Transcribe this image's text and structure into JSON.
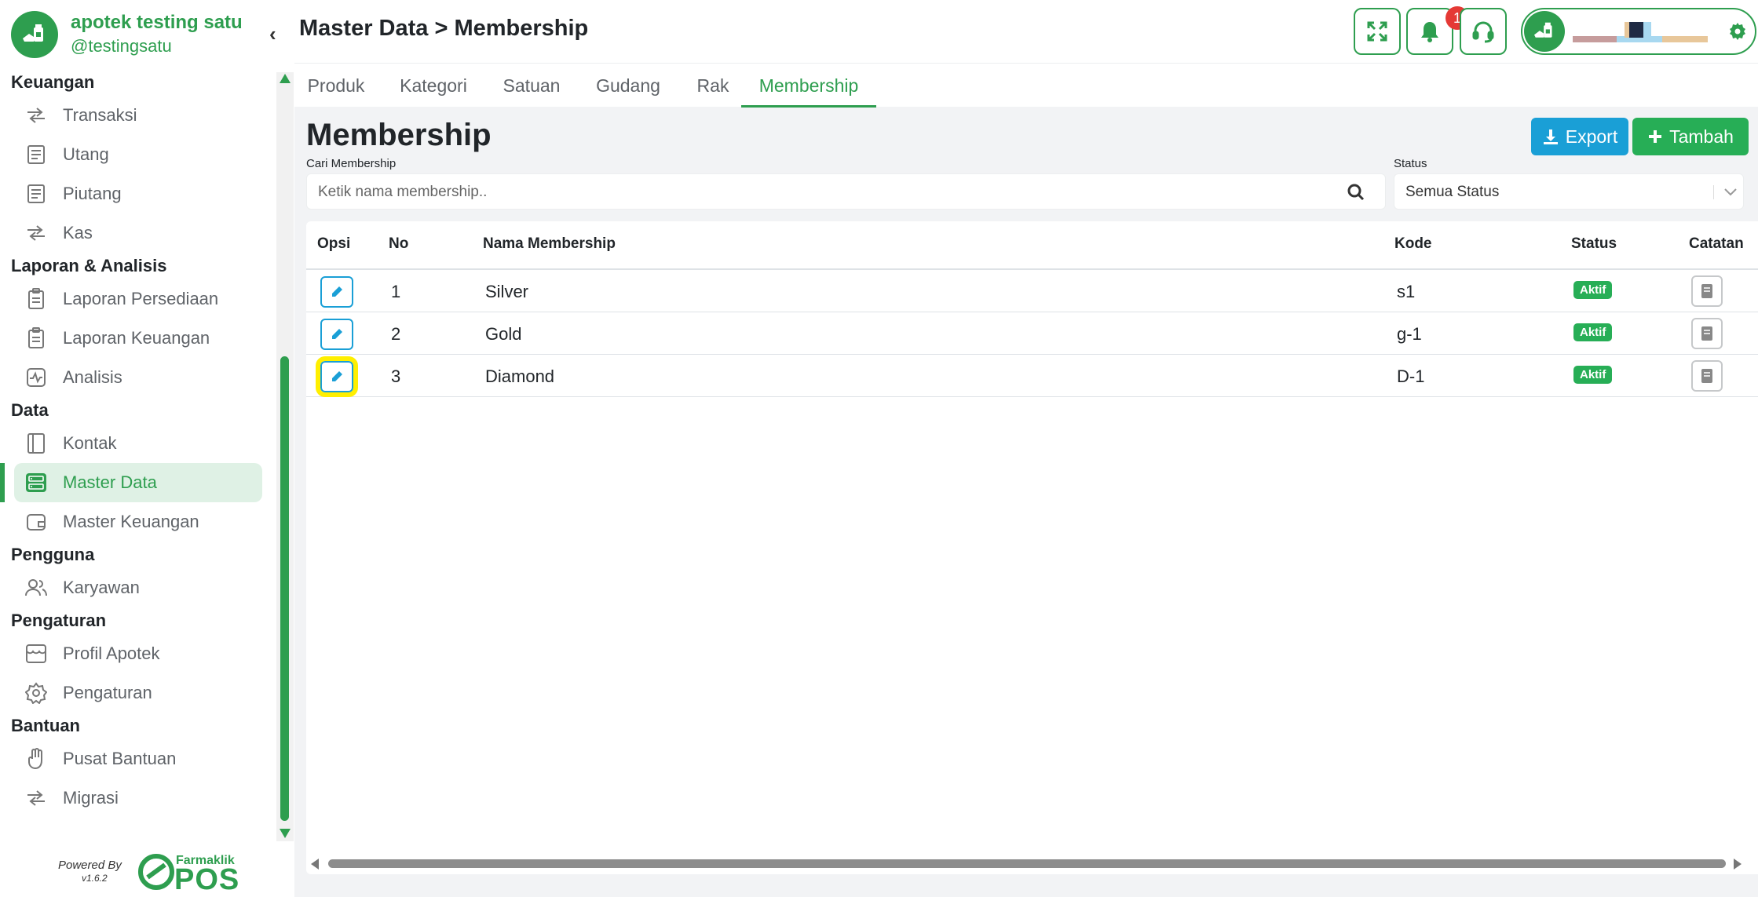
{
  "sidebar": {
    "store_name": "apotek testing satu",
    "store_handle": "@testingsatu",
    "sections": [
      {
        "title": "Keuangan",
        "items": [
          {
            "label": "Transaksi",
            "icon": "transfer-icon"
          },
          {
            "label": "Utang",
            "icon": "receipt-icon"
          },
          {
            "label": "Piutang",
            "icon": "receipt-icon"
          },
          {
            "label": "Kas",
            "icon": "transfer-icon"
          }
        ]
      },
      {
        "title": "Laporan & Analisis",
        "items": [
          {
            "label": "Laporan Persediaan",
            "icon": "clipboard-icon"
          },
          {
            "label": "Laporan Keuangan",
            "icon": "clipboard-icon"
          },
          {
            "label": "Analisis",
            "icon": "activity-icon"
          }
        ]
      },
      {
        "title": "Data",
        "items": [
          {
            "label": "Kontak",
            "icon": "contact-book-icon"
          },
          {
            "label": "Master Data",
            "icon": "database-icon",
            "active": true
          },
          {
            "label": "Master Keuangan",
            "icon": "wallet-icon"
          }
        ]
      },
      {
        "title": "Pengguna",
        "items": [
          {
            "label": "Karyawan",
            "icon": "users-icon"
          }
        ]
      },
      {
        "title": "Pengaturan",
        "items": [
          {
            "label": "Profil Apotek",
            "icon": "store-icon"
          },
          {
            "label": "Pengaturan",
            "icon": "gear-icon"
          }
        ]
      },
      {
        "title": "Bantuan",
        "items": [
          {
            "label": "Pusat Bantuan",
            "icon": "hand-icon"
          },
          {
            "label": "Migrasi",
            "icon": "transfer-icon"
          }
        ]
      }
    ],
    "powered_by": "Powered By",
    "version": "v1.6.2",
    "brand_small": "Farmaklik",
    "brand_big": "POS"
  },
  "header": {
    "breadcrumb": "Master Data > Membership",
    "notification_count": "1"
  },
  "tabs": [
    {
      "label": "Produk"
    },
    {
      "label": "Kategori"
    },
    {
      "label": "Satuan"
    },
    {
      "label": "Gudang"
    },
    {
      "label": "Rak"
    },
    {
      "label": "Membership",
      "active": true
    }
  ],
  "main": {
    "title": "Membership",
    "export_label": "Export",
    "add_label": "Tambah",
    "search_label": "Cari Membership",
    "search_placeholder": "Ketik nama membership..",
    "status_label": "Status",
    "status_value": "Semua Status"
  },
  "table": {
    "columns": [
      "Opsi",
      "No",
      "Nama Membership",
      "Kode",
      "Status",
      "Catatan"
    ],
    "rows": [
      {
        "no": "1",
        "name": "Silver",
        "code": "s1",
        "status": "Aktif"
      },
      {
        "no": "2",
        "name": "Gold",
        "code": "g-1",
        "status": "Aktif"
      },
      {
        "no": "3",
        "name": "Diamond",
        "code": "D-1",
        "status": "Aktif"
      }
    ]
  },
  "colors": {
    "primary": "#2e9e4f",
    "export": "#1a9fd6",
    "badge": "#27ae56",
    "highlight": "#ffef00"
  }
}
